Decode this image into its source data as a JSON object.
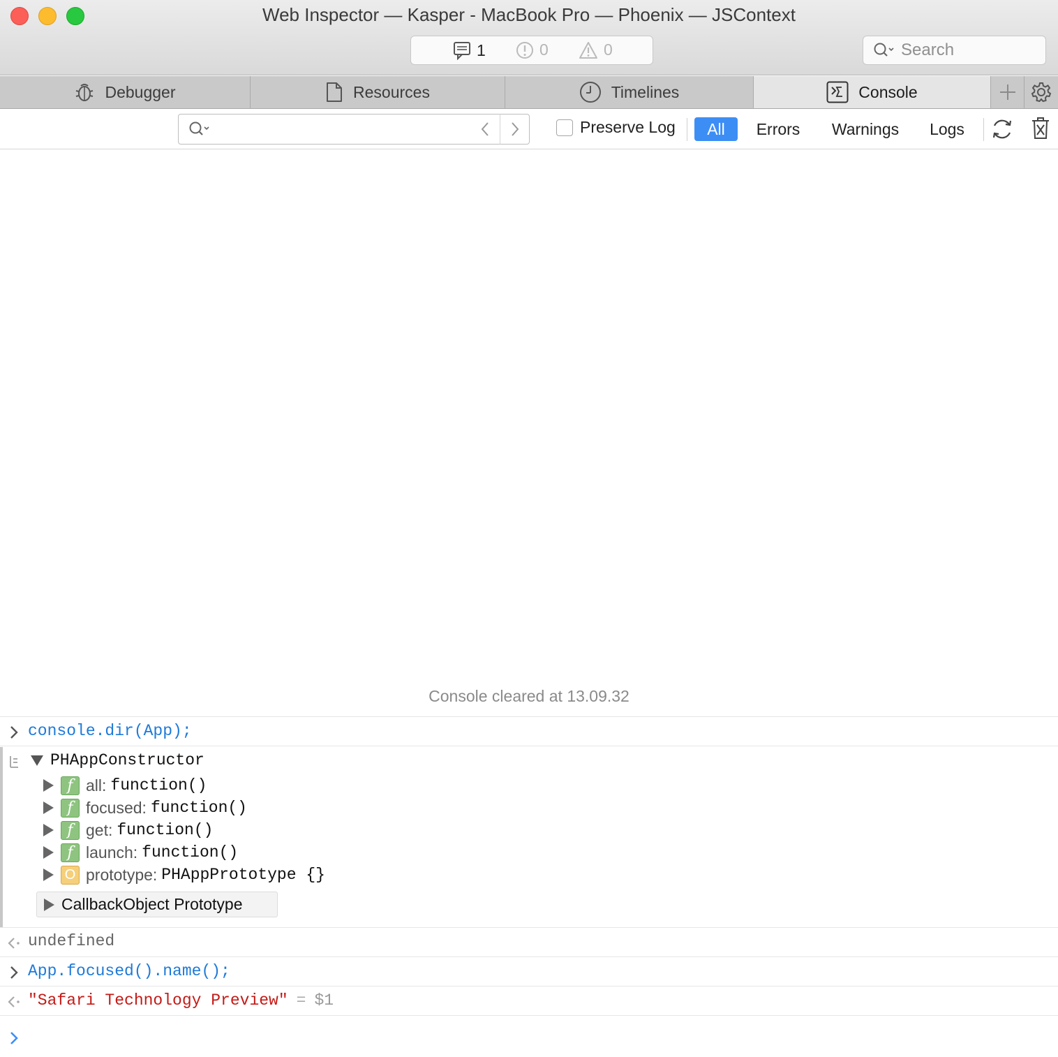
{
  "window": {
    "title": "Web Inspector — Kasper - MacBook Pro — Phoenix — JSContext"
  },
  "counts": {
    "logs": "1",
    "errors": "0",
    "warnings": "0"
  },
  "search": {
    "placeholder": "Search"
  },
  "tabs": [
    {
      "label": "Debugger",
      "icon": "bug-icon"
    },
    {
      "label": "Resources",
      "icon": "document-icon"
    },
    {
      "label": "Timelines",
      "icon": "clock-icon"
    },
    {
      "label": "Console",
      "icon": "console-icon",
      "active": true
    }
  ],
  "filter": {
    "preserve_log_label": "Preserve Log",
    "buttons": [
      "All",
      "Errors",
      "Warnings",
      "Logs"
    ],
    "active": "All"
  },
  "console": {
    "cleared_message": "Console cleared at 13.09.32",
    "command1": "console.dir(App);",
    "dir_object": "PHAppConstructor",
    "properties": [
      {
        "name": "all:",
        "value": "function()",
        "kind": "function"
      },
      {
        "name": "focused:",
        "value": "function()",
        "kind": "function"
      },
      {
        "name": "get:",
        "value": "function()",
        "kind": "function"
      },
      {
        "name": "launch:",
        "value": "function()",
        "kind": "function"
      },
      {
        "name": "prototype:",
        "value": "PHAppPrototype {}",
        "kind": "object"
      }
    ],
    "prototype_label": "CallbackObject Prototype",
    "result1": "undefined",
    "command2": "App.focused().name();",
    "result2_string": "\"Safari Technology Preview\"",
    "result2_eq": "=",
    "result2_ref": "$1"
  },
  "colors": {
    "accent": "#3c8ef5",
    "command": "#1e7ad8",
    "string": "#c41a16"
  }
}
